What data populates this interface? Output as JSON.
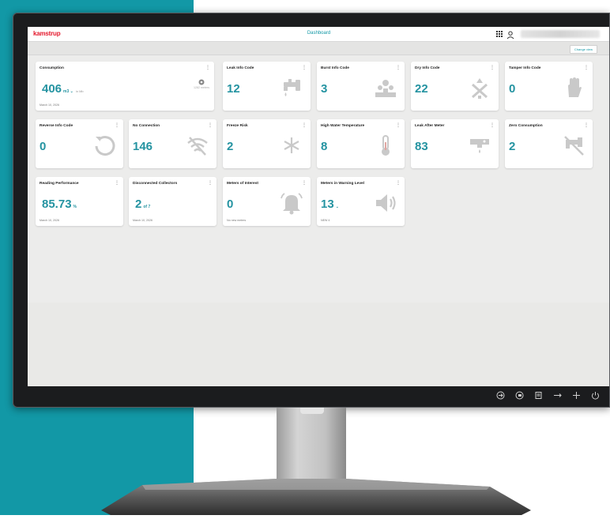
{
  "app": {
    "logo": "kamstrup",
    "title": "Dashboard",
    "change_view": "Change view"
  },
  "tiles": [
    {
      "title": "Consumption",
      "value": "406",
      "unit": "m3 ⌄",
      "sub": "in Mb",
      "foot": "March 10, 2026",
      "note": "1282 meters",
      "icon": "meter-icon"
    },
    {
      "title": "Leak Info Code",
      "value": "12",
      "icon": "faucet-drip-icon"
    },
    {
      "title": "Burst Info Code",
      "value": "3",
      "icon": "burst-icon"
    },
    {
      "title": "Dry Info Code",
      "value": "22",
      "icon": "dry-icon"
    },
    {
      "title": "Tamper Info Code",
      "value": "0",
      "icon": "hand-icon"
    },
    {
      "title": "Reverse Info Code",
      "value": "0",
      "icon": "reverse-icon"
    },
    {
      "title": "No Connection",
      "value": "146",
      "icon": "no-wifi-icon"
    },
    {
      "title": "Freeze Risk",
      "value": "2",
      "icon": "snowflake-icon"
    },
    {
      "title": "High Water Temperature",
      "value": "8",
      "icon": "thermometer-icon"
    },
    {
      "title": "Leak After Meter",
      "value": "83",
      "icon": "pipe-leak-icon"
    },
    {
      "title": "Zero Consumption",
      "value": "2",
      "icon": "zero-consumption-icon"
    },
    {
      "title": "Reading Performance",
      "value": "85.73",
      "unit": "%",
      "foot": "March 10, 2026"
    },
    {
      "title": "Disconnected Collectors",
      "value": "2",
      "unit": "of 7",
      "foot": "March 10, 2026"
    },
    {
      "title": "Meters of Interest",
      "value": "0",
      "foot": "No new meters",
      "icon": "bell-icon"
    },
    {
      "title": "Meters in Warning Level",
      "value": "13",
      "unit": "⌄",
      "foot": "NEW 4",
      "icon": "speaker-icon"
    }
  ],
  "taskbar": {
    "icons": [
      "input-source-icon",
      "pip-icon",
      "menu-icon",
      "arrow-left-icon",
      "arrow-right-icon",
      "power-icon"
    ]
  },
  "colors": {
    "accent": "#1298a6",
    "brand": "#e4172b",
    "value": "#2493a1",
    "background": "#ececeb"
  }
}
